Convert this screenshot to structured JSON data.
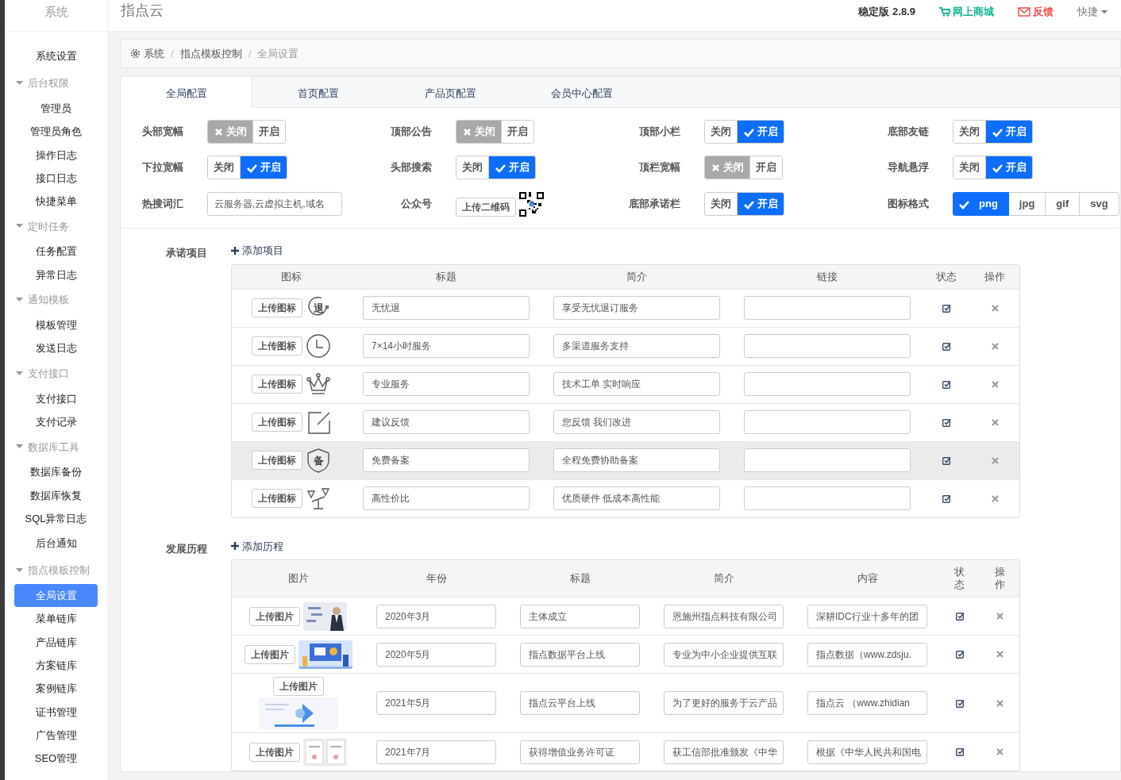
{
  "header": {
    "sidebar_title": "系统",
    "title": "指点云",
    "version": "稳定版 2.8.9",
    "links": [
      {
        "kind": "shop",
        "label": "网上商城"
      },
      {
        "kind": "feedback",
        "label": "反馈"
      },
      {
        "kind": "menu",
        "label": "快捷"
      }
    ]
  },
  "sidebar": {
    "items": [
      {
        "kind": "link",
        "label": "系统设置",
        "selected": false
      },
      {
        "kind": "group",
        "label": "后台权限",
        "expanded": true,
        "children": [
          {
            "label": "管理员",
            "selected": false
          },
          {
            "label": "管理员角色",
            "selected": false
          },
          {
            "label": "操作日志",
            "selected": false
          },
          {
            "label": "接口日志",
            "selected": false
          },
          {
            "label": "快捷菜单",
            "selected": false
          }
        ]
      },
      {
        "kind": "group",
        "label": "定时任务",
        "expanded": true,
        "children": [
          {
            "label": "任务配置",
            "selected": false
          },
          {
            "label": "异常日志",
            "selected": false
          }
        ]
      },
      {
        "kind": "group",
        "label": "通知模板",
        "expanded": true,
        "children": [
          {
            "label": "模板管理",
            "selected": false
          },
          {
            "label": "发送日志",
            "selected": false
          }
        ]
      },
      {
        "kind": "group",
        "label": "支付接口",
        "expanded": true,
        "children": [
          {
            "label": "支付接口",
            "selected": false
          },
          {
            "label": "支付记录",
            "selected": false
          }
        ]
      },
      {
        "kind": "group",
        "label": "数据库工具",
        "expanded": true,
        "children": [
          {
            "label": "数据库备份",
            "selected": false
          },
          {
            "label": "数据库恢复",
            "selected": false
          },
          {
            "label": "SQL异常日志",
            "selected": false
          }
        ]
      },
      {
        "kind": "link",
        "label": "后台通知",
        "selected": false
      },
      {
        "kind": "group",
        "label": "指点模板控制",
        "expanded": true,
        "children": [
          {
            "label": "全局设置",
            "selected": true
          },
          {
            "label": "菜单链库",
            "selected": false
          },
          {
            "label": "产品链库",
            "selected": false
          },
          {
            "label": "方案链库",
            "selected": false
          },
          {
            "label": "案例链库",
            "selected": false
          },
          {
            "label": "证书管理",
            "selected": false
          },
          {
            "label": "广告管理",
            "selected": false
          },
          {
            "label": "SEO管理",
            "selected": false
          }
        ]
      }
    ]
  },
  "breadcrumb": {
    "separator": "/",
    "items": [
      "系统",
      "指点模板控制",
      "全局设置"
    ]
  },
  "tabs": [
    {
      "label": "全局配置",
      "selected": true
    },
    {
      "label": "首页配置",
      "selected": false
    },
    {
      "label": "产品页配置",
      "selected": false
    },
    {
      "label": "会员中心配置",
      "selected": false
    }
  ],
  "settings": [
    {
      "kind": "toggle",
      "label": "头部宽幅",
      "off_label": "关闭",
      "on_label": "开启",
      "on": false
    },
    {
      "kind": "toggle",
      "label": "顶部公告",
      "off_label": "关闭",
      "on_label": "开启",
      "on": false
    },
    {
      "kind": "toggle",
      "label": "顶部小栏",
      "off_label": "关闭",
      "on_label": "开启",
      "on": true
    },
    {
      "kind": "toggle",
      "label": "底部友链",
      "off_label": "关闭",
      "on_label": "开启",
      "on": true
    },
    {
      "kind": "toggle",
      "label": "下拉宽幅",
      "off_label": "关闭",
      "on_label": "开启",
      "on": true
    },
    {
      "kind": "toggle",
      "label": "头部搜索",
      "off_label": "关闭",
      "on_label": "开启",
      "on": true
    },
    {
      "kind": "toggle",
      "label": "顶栏宽幅",
      "off_label": "关闭",
      "on_label": "开启",
      "on": false
    },
    {
      "kind": "toggle",
      "label": "导航悬浮",
      "off_label": "关闭",
      "on_label": "开启",
      "on": true
    },
    {
      "kind": "input",
      "label": "热搜词汇",
      "value": "云服务器,云虚拟主机,域名"
    },
    {
      "kind": "upload",
      "label": "公众号",
      "button": "上传二维码"
    },
    {
      "kind": "toggle",
      "label": "底部承诺栏",
      "off_label": "关闭",
      "on_label": "开启",
      "on": true
    },
    {
      "kind": "choice",
      "label": "图标格式",
      "options": [
        {
          "label": "png",
          "selected": true
        },
        {
          "label": "jpg",
          "selected": false
        },
        {
          "label": "gif",
          "selected": false
        },
        {
          "label": "svg",
          "selected": false
        }
      ]
    }
  ],
  "promises": {
    "label": "承诺项目",
    "add": "添加项目",
    "columns": [
      "图标",
      "标题",
      "简介",
      "链接",
      "状态",
      "操作"
    ],
    "rows": [
      {
        "button": "上传图标",
        "kind": "return",
        "glyph": "退",
        "title": "无忧退",
        "summary": "享受无忧退订服务",
        "enabled": true,
        "hovered": false
      },
      {
        "button": "上传图标",
        "kind": "clock",
        "title": "7×14小时服务",
        "summary": "多渠道服务支持",
        "enabled": true,
        "hovered": false
      },
      {
        "button": "上传图标",
        "kind": "crown",
        "title": "专业服务",
        "summary": "技术工单 实时响应",
        "enabled": true,
        "hovered": false
      },
      {
        "button": "上传图标",
        "kind": "edit",
        "title": "建议反馈",
        "summary": "您反馈 我们改进",
        "enabled": true,
        "hovered": false
      },
      {
        "button": "上传图标",
        "kind": "shield",
        "glyph": "备",
        "title": "免费备案",
        "summary": "全程免费协助备案",
        "enabled": true,
        "hovered": true
      },
      {
        "button": "上传图标",
        "kind": "scale",
        "title": "高性价比",
        "summary": "优质硬件 低成本高性能",
        "enabled": true,
        "hovered": false
      }
    ]
  },
  "history": {
    "label": "发展历程",
    "add": "添加历程",
    "columns": [
      "图片",
      "年份",
      "标题",
      "简介",
      "内容",
      "状态",
      "操作"
    ],
    "rows": [
      {
        "button": "上传图片",
        "year": "2020年3月",
        "title": "主体成立",
        "summary": "恩施州指点科技有限公司",
        "content": "深耕IDC行业十多年的团",
        "enabled": true
      },
      {
        "button": "上传图片",
        "year": "2020年5月",
        "title": "指点数据平台上线",
        "summary": "专业为中小企业提供互联",
        "content": "指点数据（www.zdsju.",
        "enabled": true
      },
      {
        "button": "上传图片",
        "year": "2021年5月",
        "title": "指点云平台上线",
        "summary": "为了更好的服务于云产品",
        "content": "指点云 （www.zhidian",
        "enabled": true
      },
      {
        "button": "上传图片",
        "year": "2021年7月",
        "title": "获得增值业务许可证",
        "summary": "获工信部批准颁发《中华",
        "content": "根据《中华人民共和国电",
        "enabled": true
      }
    ]
  }
}
